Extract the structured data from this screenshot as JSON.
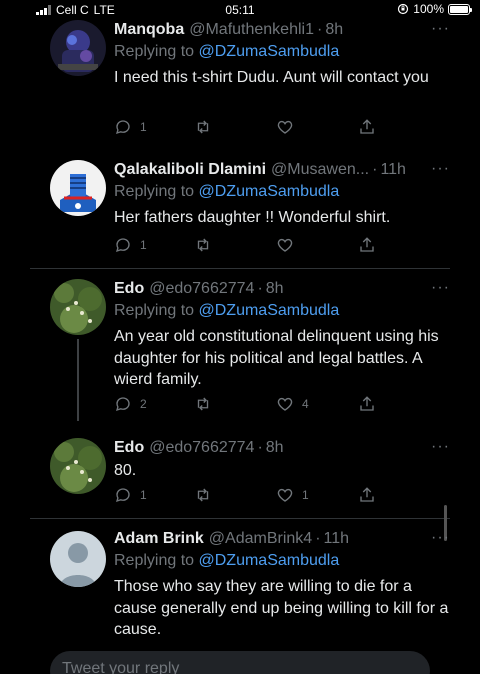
{
  "status_bar": {
    "carrier": "Cell C",
    "network": "LTE",
    "time": "05:11",
    "battery": "100%",
    "battery_level": 1.0
  },
  "tweets": [
    {
      "name": "Manqoba",
      "handle": "@Mafuthenkehli1",
      "time": "8h",
      "replying_prefix": "Replying to",
      "replying_to": "@DZumaSambudla",
      "text": "I need this t-shirt Dudu. Aunt will contact you",
      "reply_count": "1",
      "retweet_count": "",
      "like_count": "",
      "more": "···"
    },
    {
      "name": "Qalakaliboli Dlamini",
      "handle": "@Musawen...",
      "time": "11h",
      "replying_prefix": "Replying to",
      "replying_to": "@DZumaSambudla",
      "text": "Her fathers daughter !! Wonderful shirt.",
      "reply_count": "1",
      "retweet_count": "",
      "like_count": "",
      "more": "···"
    },
    {
      "name": "Edo",
      "handle": "@edo7662774",
      "time": "8h",
      "replying_prefix": "Replying to",
      "replying_to": "@DZumaSambudla",
      "text": "An year old constitutional delinquent using his daughter for his political and legal battles. A wierd family.",
      "reply_count": "2",
      "retweet_count": "",
      "like_count": "4",
      "more": "···"
    },
    {
      "name": "Edo",
      "handle": "@edo7662774",
      "time": "8h",
      "text": "80.",
      "reply_count": "1",
      "retweet_count": "",
      "like_count": "1",
      "more": "···"
    },
    {
      "name": "Adam Brink",
      "handle": "@AdamBrink4",
      "time": "11h",
      "replying_prefix": "Replying to",
      "replying_to": "@DZumaSambudla",
      "text": "Those who say they are willing to die for a cause generally end up being willing to kill for a cause.",
      "more": "···"
    }
  ],
  "reply_box": {
    "placeholder": "Tweet your reply"
  },
  "colors": {
    "background": "#000000",
    "text": "#e7e9ea",
    "muted": "#71767b",
    "link": "#4e9ef0",
    "divider": "#2f3336"
  }
}
